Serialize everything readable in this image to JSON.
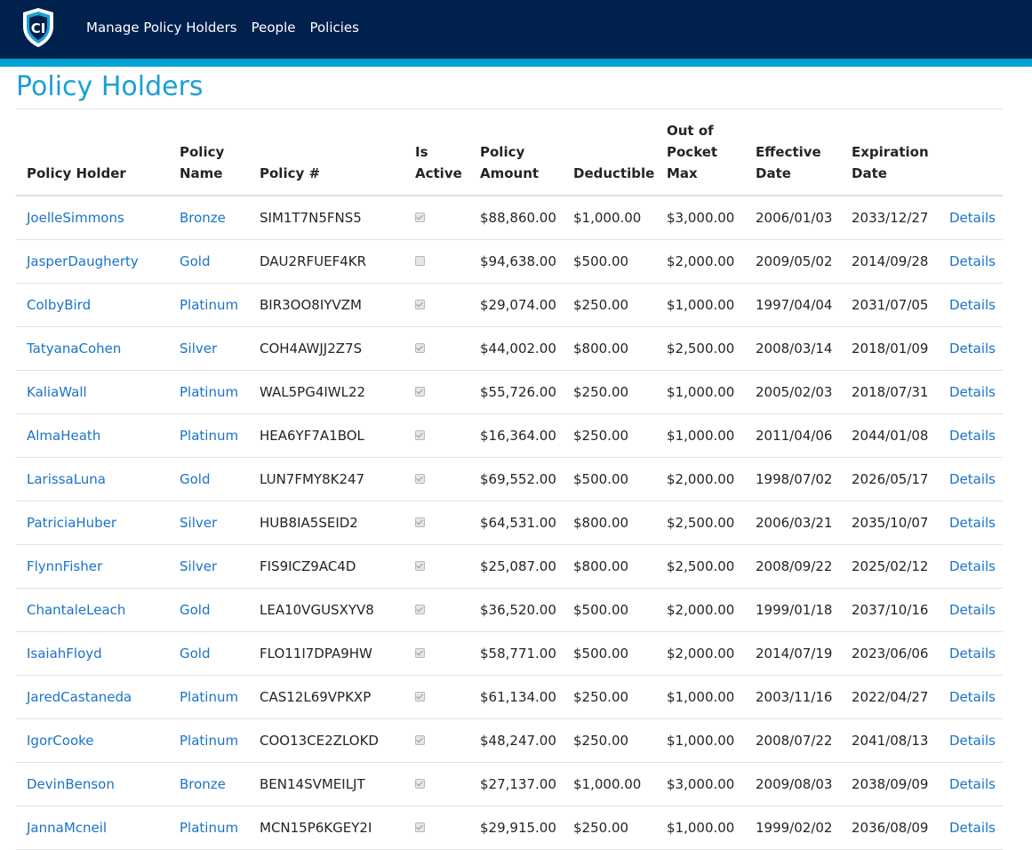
{
  "nav": {
    "logo_text": "CI",
    "links": [
      "Manage Policy Holders",
      "People",
      "Policies"
    ]
  },
  "page": {
    "title": "Policy Holders"
  },
  "colors": {
    "navbar": "#00204e",
    "accent": "#00a2d8",
    "title": "#1ba0d6",
    "link": "#1a73c7"
  },
  "table": {
    "headers": [
      "Policy Holder",
      "Policy Name",
      "Policy #",
      "Is Active",
      "Policy Amount",
      "Deductible",
      "Out of Pocket Max",
      "Effective Date",
      "Expiration Date",
      ""
    ],
    "details_label": "Details",
    "rows": [
      {
        "holder": "JoelleSimmons",
        "policy_name": "Bronze",
        "policy_no": "SIM1T7N5FNS5",
        "is_active": true,
        "amount": "$88,860.00",
        "deductible": "$1,000.00",
        "oop_max": "$3,000.00",
        "effective": "2006/01/03",
        "expiration": "2033/12/27"
      },
      {
        "holder": "JasperDaugherty",
        "policy_name": "Gold",
        "policy_no": "DAU2RFUEF4KR",
        "is_active": false,
        "amount": "$94,638.00",
        "deductible": "$500.00",
        "oop_max": "$2,000.00",
        "effective": "2009/05/02",
        "expiration": "2014/09/28"
      },
      {
        "holder": "ColbyBird",
        "policy_name": "Platinum",
        "policy_no": "BIR3OO8IYVZM",
        "is_active": true,
        "amount": "$29,074.00",
        "deductible": "$250.00",
        "oop_max": "$1,000.00",
        "effective": "1997/04/04",
        "expiration": "2031/07/05"
      },
      {
        "holder": "TatyanaCohen",
        "policy_name": "Silver",
        "policy_no": "COH4AWJJ2Z7S",
        "is_active": true,
        "amount": "$44,002.00",
        "deductible": "$800.00",
        "oop_max": "$2,500.00",
        "effective": "2008/03/14",
        "expiration": "2018/01/09"
      },
      {
        "holder": "KaliaWall",
        "policy_name": "Platinum",
        "policy_no": "WAL5PG4IWL22",
        "is_active": true,
        "amount": "$55,726.00",
        "deductible": "$250.00",
        "oop_max": "$1,000.00",
        "effective": "2005/02/03",
        "expiration": "2018/07/31"
      },
      {
        "holder": "AlmaHeath",
        "policy_name": "Platinum",
        "policy_no": "HEA6YF7A1BOL",
        "is_active": true,
        "amount": "$16,364.00",
        "deductible": "$250.00",
        "oop_max": "$1,000.00",
        "effective": "2011/04/06",
        "expiration": "2044/01/08"
      },
      {
        "holder": "LarissaLuna",
        "policy_name": "Gold",
        "policy_no": "LUN7FMY8K247",
        "is_active": true,
        "amount": "$69,552.00",
        "deductible": "$500.00",
        "oop_max": "$2,000.00",
        "effective": "1998/07/02",
        "expiration": "2026/05/17"
      },
      {
        "holder": "PatriciaHuber",
        "policy_name": "Silver",
        "policy_no": "HUB8IA5SEID2",
        "is_active": true,
        "amount": "$64,531.00",
        "deductible": "$800.00",
        "oop_max": "$2,500.00",
        "effective": "2006/03/21",
        "expiration": "2035/10/07"
      },
      {
        "holder": "FlynnFisher",
        "policy_name": "Silver",
        "policy_no": "FIS9ICZ9AC4D",
        "is_active": true,
        "amount": "$25,087.00",
        "deductible": "$800.00",
        "oop_max": "$2,500.00",
        "effective": "2008/09/22",
        "expiration": "2025/02/12"
      },
      {
        "holder": "ChantaleLeach",
        "policy_name": "Gold",
        "policy_no": "LEA10VGUSXYV8",
        "is_active": true,
        "amount": "$36,520.00",
        "deductible": "$500.00",
        "oop_max": "$2,000.00",
        "effective": "1999/01/18",
        "expiration": "2037/10/16"
      },
      {
        "holder": "IsaiahFloyd",
        "policy_name": "Gold",
        "policy_no": "FLO11I7DPA9HW",
        "is_active": true,
        "amount": "$58,771.00",
        "deductible": "$500.00",
        "oop_max": "$2,000.00",
        "effective": "2014/07/19",
        "expiration": "2023/06/06"
      },
      {
        "holder": "JaredCastaneda",
        "policy_name": "Platinum",
        "policy_no": "CAS12L69VPKXP",
        "is_active": true,
        "amount": "$61,134.00",
        "deductible": "$250.00",
        "oop_max": "$1,000.00",
        "effective": "2003/11/16",
        "expiration": "2022/04/27"
      },
      {
        "holder": "IgorCooke",
        "policy_name": "Platinum",
        "policy_no": "COO13CE2ZLOKD",
        "is_active": true,
        "amount": "$48,247.00",
        "deductible": "$250.00",
        "oop_max": "$1,000.00",
        "effective": "2008/07/22",
        "expiration": "2041/08/13"
      },
      {
        "holder": "DevinBenson",
        "policy_name": "Bronze",
        "policy_no": "BEN14SVMEILJT",
        "is_active": true,
        "amount": "$27,137.00",
        "deductible": "$1,000.00",
        "oop_max": "$3,000.00",
        "effective": "2009/08/03",
        "expiration": "2038/09/09"
      },
      {
        "holder": "JannaMcneil",
        "policy_name": "Platinum",
        "policy_no": "MCN15P6KGEY2I",
        "is_active": true,
        "amount": "$29,915.00",
        "deductible": "$250.00",
        "oop_max": "$1,000.00",
        "effective": "1999/02/02",
        "expiration": "2036/08/09"
      }
    ]
  }
}
